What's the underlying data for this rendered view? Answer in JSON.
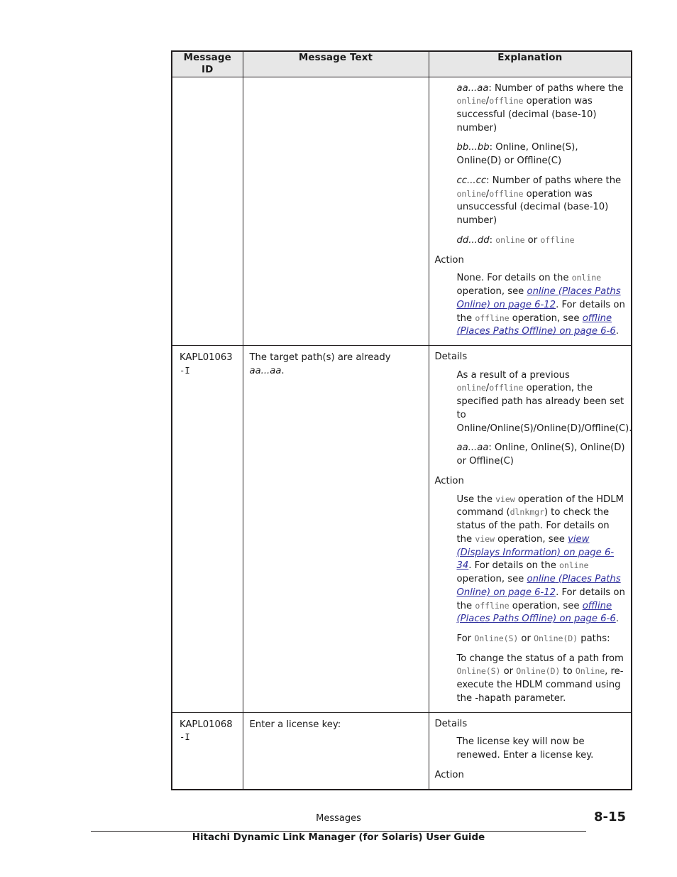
{
  "document": {
    "page_number": "8-15",
    "footer_chapter": "Messages",
    "footer_title": "Hitachi Dynamic Link Manager (for Solaris) User Guide",
    "link_color": "#2e2e9e",
    "header_bg": "#e7e7e7",
    "mono_color": "#6d6d6d"
  },
  "table": {
    "headers": {
      "message_id": "Message ID",
      "message_id_line1": "Message",
      "message_id_line2": "ID",
      "message_text": "Message Text",
      "explanation": "Explanation"
    },
    "rows": [
      {
        "id_main": "",
        "id_suffix": "",
        "message_text": "",
        "explanation": {
          "p1_var": "aa...aa",
          "p1_a": ": Number of paths where the ",
          "p1_mono1": "online",
          "p1_slash": "/",
          "p1_mono2": "offline",
          "p1_b": " operation was successful (decimal (base-10) number)",
          "p2_var": "bb...bb",
          "p2_text": ": Online, Online(S), Online(D) or Offline(C)",
          "p3_var": "cc...cc",
          "p3_a": ": Number of paths where the ",
          "p3_mono1": "online",
          "p3_slash": "/",
          "p3_mono2": "offline",
          "p3_b": " operation was unsuccessful (decimal (base-10) number)",
          "p4_var": "dd...dd",
          "p4_colon": ": ",
          "p4_mono1": "online",
          "p4_or": " or ",
          "p4_mono2": "offline",
          "action_head": "Action",
          "act_a": "None. For details on the ",
          "act_mono1": "online",
          "act_b": " operation, see ",
          "act_link1": "online (Places Paths Online) on page 6-12",
          "act_c": ". For details on the ",
          "act_mono2": "offline",
          "act_d": " operation, see ",
          "act_link2": "offline (Places Paths Offline) on page 6-6",
          "act_e": "."
        }
      },
      {
        "id_main": "KAPL01063",
        "id_suffix": "-I",
        "msg_a": "The target path(s) are already ",
        "msg_var": "aa...aa",
        "msg_b": ".",
        "explanation": {
          "details_head": "Details",
          "d_a": "As a result of a previous ",
          "d_mono1": "online",
          "d_slash": "/",
          "d_mono2": "offline",
          "d_b": " operation, the specified path has already been set to Online/Online(S)/Online(D)/Offline(C).",
          "d2_var": "aa...aa",
          "d2_text": ": Online, Online(S), Online(D) or Offline(C)",
          "action_head": "Action",
          "a_a": "Use the ",
          "a_mono1": "view",
          "a_b": " operation of the HDLM command (",
          "a_mono2": "dlnkmgr",
          "a_c": ") to check the status of the path. For details on the ",
          "a_mono3": "view",
          "a_d": " operation, see ",
          "a_link1": "view (Displays Information) on page 6-34",
          "a_e": ". For details on the ",
          "a_mono4": "online",
          "a_f": " operation, see ",
          "a_link2_mono": "online",
          "a_link2_rest": " (Places Paths Online) on page 6-12",
          "a_g": ". For details on the ",
          "a_mono5": "offline",
          "a_h": " operation, see ",
          "a_link3_mono": "offline",
          "a_link3_rest": " (Places Paths Offline) on page 6-6",
          "a_i": ".",
          "f_for": "For ",
          "f_mono1": "Online(S)",
          "f_or": " or ",
          "f_mono2": "Online(D)",
          "f_paths": " paths:",
          "g_a": "To change the status of a path from ",
          "g_mono1": "Online(S)",
          "g_or": " or ",
          "g_mono2": "Online(D)",
          "g_to": " to ",
          "g_mono3": "Online",
          "g_b": ", re-execute the HDLM command using the -hapath parameter."
        }
      },
      {
        "id_main": "KAPL01068",
        "id_suffix": "-I",
        "message_text": "Enter a license key:",
        "explanation": {
          "details_head": "Details",
          "d_text": "The license key will now be renewed. Enter a license key.",
          "action_head": "Action"
        }
      }
    ]
  }
}
